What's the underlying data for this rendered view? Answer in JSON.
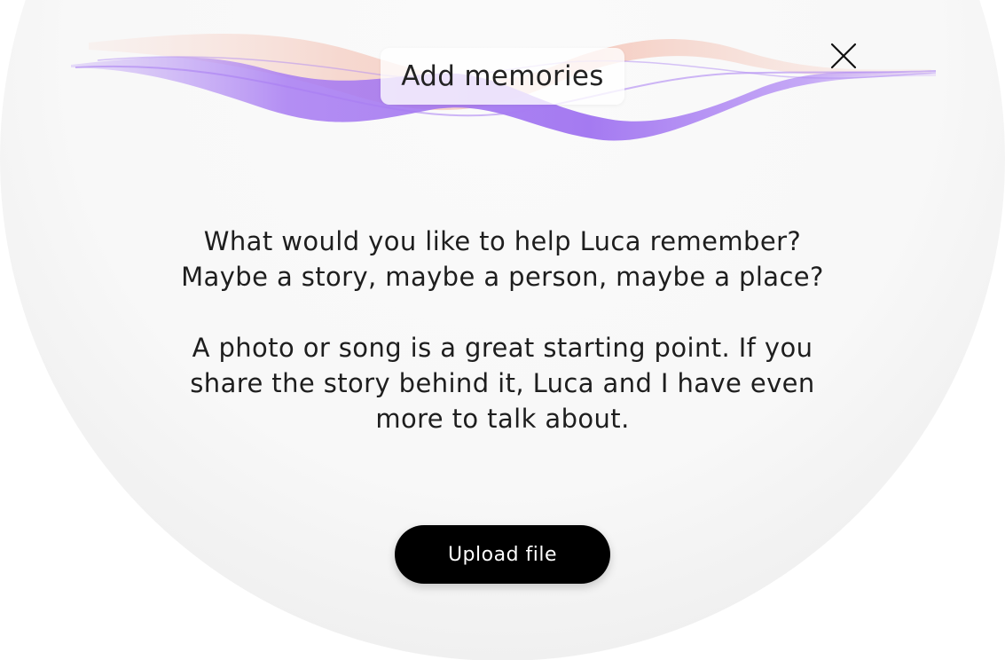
{
  "dialog": {
    "title": "Add memories",
    "close_icon": "close-icon",
    "message_lines_1": [
      "What would you like to help Luca remember?",
      "Maybe a story, maybe a person, maybe a place?"
    ],
    "message_lines_2": [
      "A photo or song is a great starting point. If you",
      "share the story behind it, Luca and I have even",
      "more to talk about."
    ],
    "upload_label": "Upload file"
  },
  "colors": {
    "wave_purple": "#a77bf2",
    "wave_pink": "#f2b7a8",
    "button_bg": "#000000",
    "button_text": "#ffffff"
  }
}
